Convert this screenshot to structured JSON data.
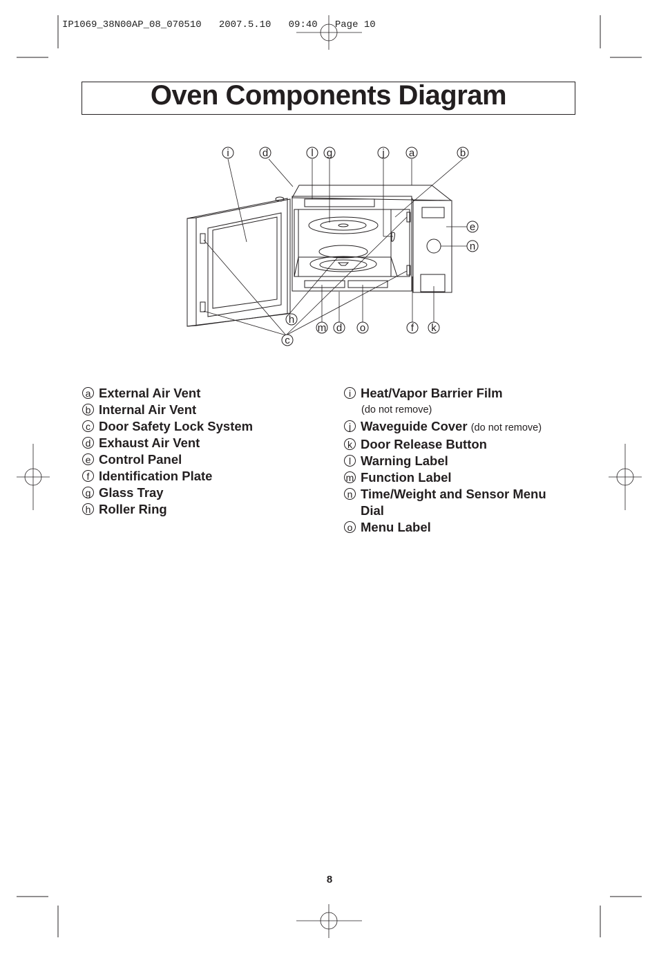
{
  "slug": "IP1069_38N00AP_08_070510   2007.5.10   09:40   Page 10",
  "title": "Oven Components Diagram",
  "diagram": {
    "callouts": [
      "i",
      "d",
      "l",
      "g",
      "j",
      "a",
      "b",
      "e",
      "n",
      "h",
      "c",
      "m",
      "d",
      "o",
      "f",
      "k"
    ]
  },
  "legend": {
    "left": [
      {
        "letter": "a",
        "label": "External Air Vent"
      },
      {
        "letter": "b",
        "label": "Internal Air Vent"
      },
      {
        "letter": "c",
        "label": "Door Safety Lock System"
      },
      {
        "letter": "d",
        "label": "Exhaust Air Vent"
      },
      {
        "letter": "e",
        "label": "Control Panel"
      },
      {
        "letter": "f",
        "label": "Identification Plate"
      },
      {
        "letter": "g",
        "label": "Glass Tray"
      },
      {
        "letter": "h",
        "label": "Roller Ring"
      }
    ],
    "right": [
      {
        "letter": "i",
        "label": "Heat/Vapor Barrier Film",
        "subnote": "(do not remove)"
      },
      {
        "letter": "j",
        "label": "Waveguide Cover",
        "note": "(do not remove)"
      },
      {
        "letter": "k",
        "label": "Door Release Button"
      },
      {
        "letter": "l",
        "label": "Warning Label"
      },
      {
        "letter": "m",
        "label": "Function Label"
      },
      {
        "letter": "n",
        "label": "Time/Weight and Sensor Menu",
        "label2": "Dial"
      },
      {
        "letter": "o",
        "label": "Menu Label"
      }
    ]
  },
  "page_number": "8"
}
